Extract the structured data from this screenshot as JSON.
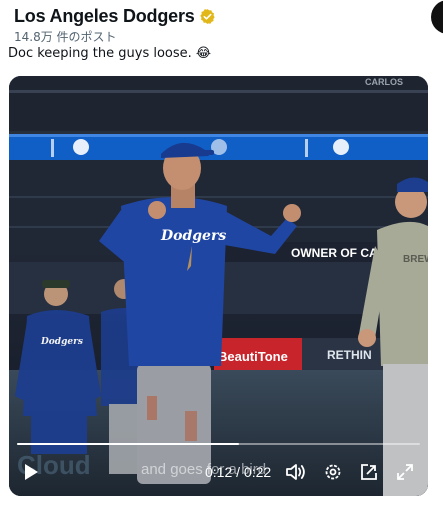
{
  "header": {
    "account_name": "Los Angeles Dodgers",
    "post_count": "14.8万 件のポスト"
  },
  "tweet": {
    "text": "Doc keeping the guys loose.",
    "emoji": "😂"
  },
  "video": {
    "caption": "and goes for a bird",
    "current_time": "0:12",
    "duration": "0:22",
    "time_display": "0:12 / 0:22",
    "progress": 0.55,
    "scene_text": {
      "board_top": "CARLOS",
      "board_ad": "OWNER OF CANA",
      "board_brand": "BeautiTone",
      "board_right": "RETHIN",
      "jersey_text": "Dodgers",
      "shirt_text": "BREW BAS",
      "lower_sign": "Cloud"
    }
  },
  "colors": {
    "dodger_blue": "#1f3f8f",
    "video_bg": "#1a2233",
    "verified_gold": "#e2b719"
  },
  "icons": [
    "verified-badge-icon",
    "play-icon",
    "volume-icon",
    "settings-icon",
    "pip-icon",
    "fullscreen-icon"
  ]
}
